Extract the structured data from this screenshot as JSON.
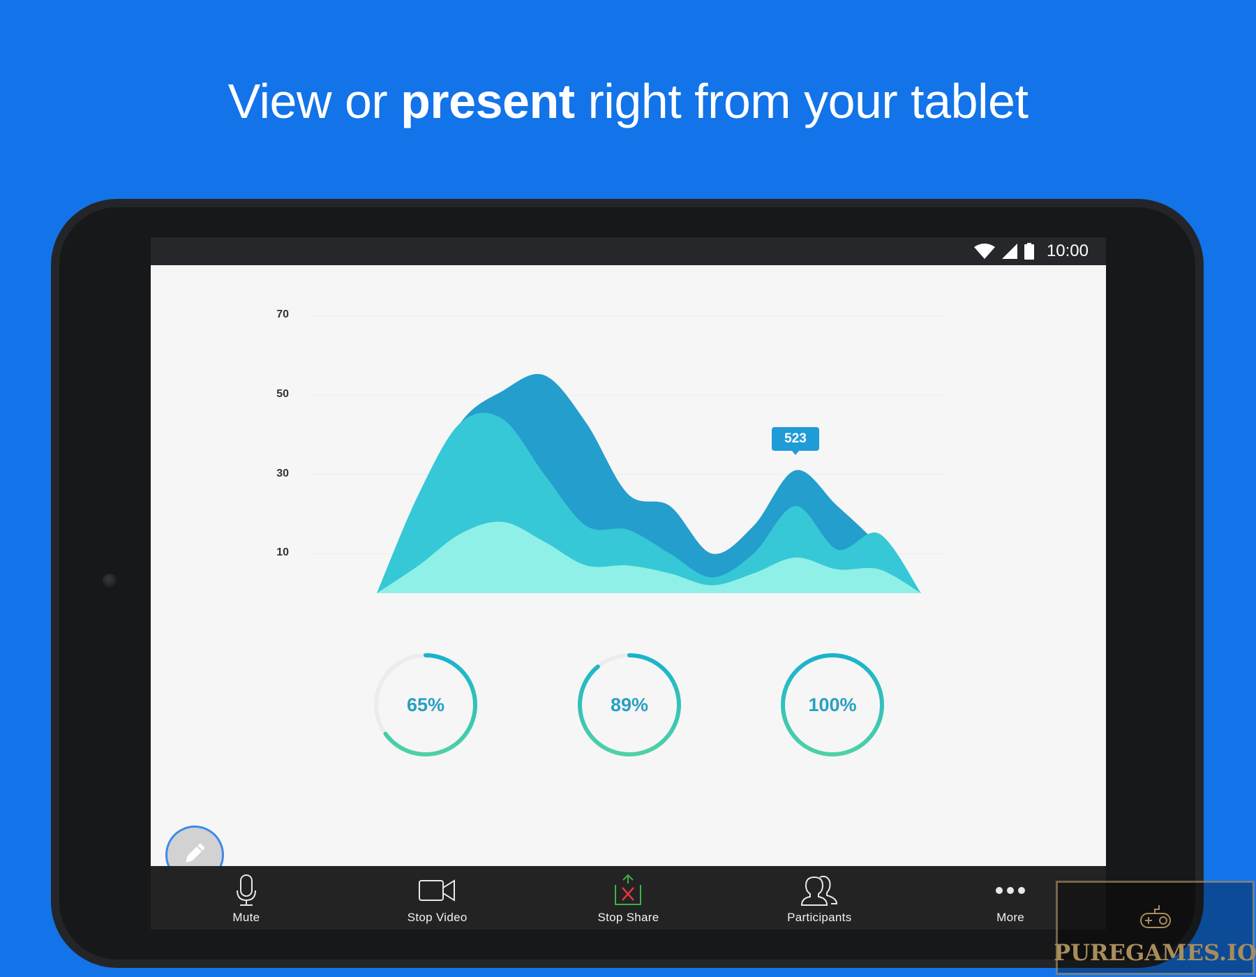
{
  "headline": {
    "before": "View or ",
    "bold": "present",
    "after": " right from your tablet"
  },
  "status_bar": {
    "icons": [
      "wifi-icon",
      "cellular-signal-icon",
      "battery-icon"
    ],
    "time": "10:00"
  },
  "chart_data": {
    "type": "area",
    "stacked": true,
    "title": "",
    "xlabel": "",
    "ylabel": "",
    "y_ticks": [
      70,
      50,
      30,
      10
    ],
    "ylim": [
      0,
      70
    ],
    "grid": true,
    "x": [
      0,
      1,
      2,
      3,
      4,
      5,
      6,
      7,
      8,
      9,
      10,
      11,
      12,
      13
    ],
    "series": [
      {
        "name": "series-top",
        "color": "#249ecc",
        "cumulative_values": [
          0,
          22,
          43,
          51,
          55,
          43,
          25,
          22,
          10,
          17,
          31,
          22,
          12,
          0
        ]
      },
      {
        "name": "series-middle",
        "color": "#36c8d6",
        "cumulative_values": [
          0,
          25,
          43,
          44,
          30,
          17,
          16,
          10,
          4,
          10,
          22,
          11,
          15,
          0
        ]
      },
      {
        "name": "series-bottom",
        "color": "#8ff0e8",
        "cumulative_values": [
          0,
          7,
          15,
          18,
          13,
          7,
          7,
          5,
          2,
          5,
          9,
          6,
          6,
          0
        ]
      }
    ],
    "annotations": [
      {
        "label": "523",
        "x": 10,
        "series": "series-top"
      }
    ]
  },
  "gauges": [
    {
      "label": "65%",
      "value": 0.65
    },
    {
      "label": "89%",
      "value": 0.89
    },
    {
      "label": "100%",
      "value": 1.0
    }
  ],
  "gauge_colors": {
    "start": "#4fd1a5",
    "end": "#18b3cd",
    "track": "#ececec"
  },
  "annotate_button": {
    "icon": "pencil-icon"
  },
  "toolbar": {
    "items": [
      {
        "label": "Mute",
        "icon": "microphone-icon"
      },
      {
        "label": "Stop Video",
        "icon": "video-camera-icon"
      },
      {
        "label": "Stop Share",
        "icon": "stop-share-icon"
      },
      {
        "label": "Participants",
        "icon": "participants-icon"
      },
      {
        "label": "More",
        "icon": "more-icon"
      }
    ]
  },
  "watermark": {
    "text": "PUREGAMES.IO",
    "icon": "gamepad-icon"
  },
  "colors": {
    "background": "#1373e9",
    "tablet_body": "#17181a",
    "screen_bg": "#f6f6f6",
    "tooltip": "#1f9bd7",
    "gauge_text": "#2a9fc0",
    "stop_share_arrow": "#3db249",
    "stop_share_x": "#e0373b"
  }
}
